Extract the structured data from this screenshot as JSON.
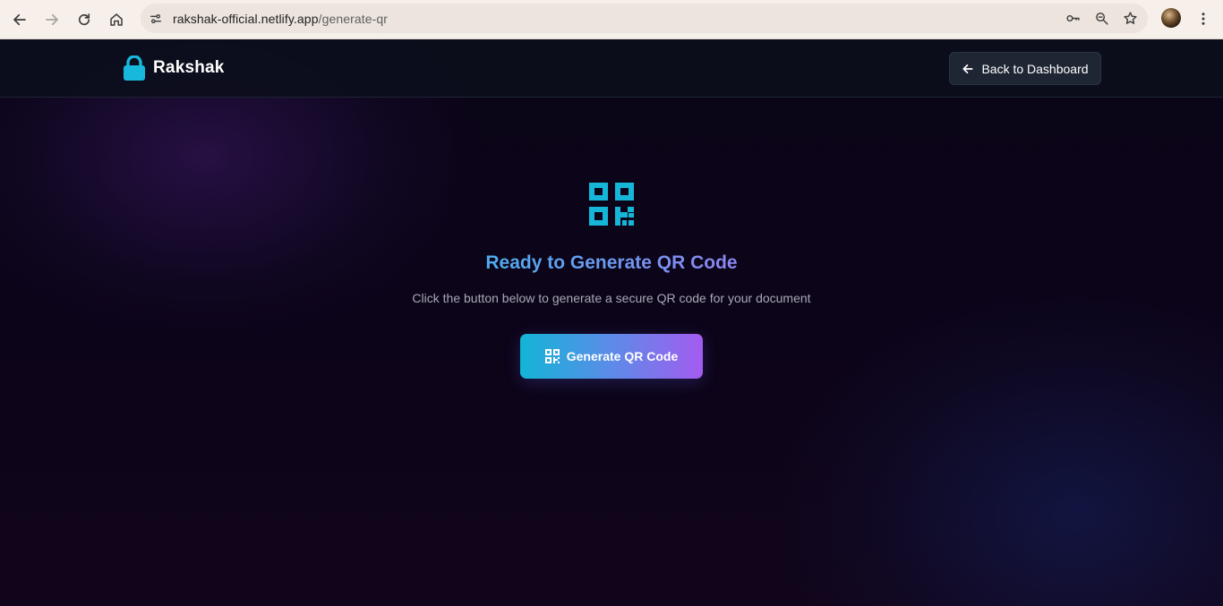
{
  "browser": {
    "url_host": "rakshak-official.netlify.app",
    "url_path": "/generate-qr"
  },
  "header": {
    "brand_name": "Rakshak",
    "back_label": "Back to Dashboard"
  },
  "main": {
    "title": "Ready to Generate QR Code",
    "subtitle": "Click the button below to generate a secure QR code for your document",
    "generate_label": "Generate QR Code"
  },
  "colors": {
    "accent_cyan": "#13b5d6",
    "accent_purple": "#a35cf0",
    "brand_lock": "#18b7dc",
    "nav_bg": "#0c0e1c",
    "page_bg": "#0c0519"
  },
  "icons": {
    "back": "arrow-left-icon",
    "forward": "arrow-right-icon",
    "reload": "reload-icon",
    "home": "home-icon",
    "site_info": "tune-icon",
    "password": "key-icon",
    "zoom": "zoom-icon",
    "bookmark": "star-icon",
    "menu": "more-vert-icon",
    "brand": "lock-icon",
    "qr": "qrcode-icon"
  }
}
